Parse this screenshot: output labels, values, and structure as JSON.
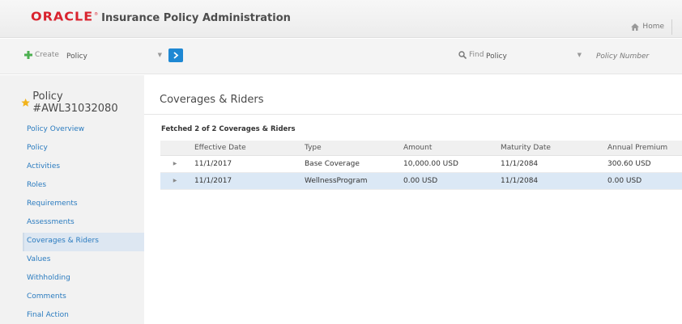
{
  "header": {
    "logo_brand": "ORACLE",
    "logo_mark": "®",
    "app_title": "Insurance Policy Administration",
    "home_label": "Home",
    "home_icon": "home-icon"
  },
  "toolbar": {
    "create_icon": "plus-icon",
    "create_label": "Create",
    "create_value": "Policy",
    "go_icon": "chevron-right-icon",
    "find_icon": "search-icon",
    "find_label": "Find",
    "find_value": "Policy",
    "policy_number_placeholder": "Policy Number"
  },
  "sidebar": {
    "policy_title": "Policy #AWL31032080",
    "favorite_icon": "star-icon",
    "items": [
      {
        "label": "Policy Overview",
        "active": false
      },
      {
        "label": "Policy",
        "active": false
      },
      {
        "label": "Activities",
        "active": false
      },
      {
        "label": "Roles",
        "active": false
      },
      {
        "label": "Requirements",
        "active": false
      },
      {
        "label": "Assessments",
        "active": false
      },
      {
        "label": "Coverages & Riders",
        "active": true
      },
      {
        "label": "Values",
        "active": false
      },
      {
        "label": "Withholding",
        "active": false
      },
      {
        "label": "Comments",
        "active": false
      },
      {
        "label": "Final Action",
        "active": false
      }
    ]
  },
  "main": {
    "title": "Coverages & Riders",
    "fetched_text": "Fetched 2 of 2 Coverages & Riders",
    "columns": [
      "Effective Date",
      "Type",
      "Amount",
      "Maturity Date",
      "Annual Premium"
    ],
    "rows": [
      {
        "effective_date": "11/1/2017",
        "type": "Base Coverage",
        "amount": "10,000.00 USD",
        "maturity_date": "11/1/2084",
        "annual_premium": "300.60 USD",
        "selected": false
      },
      {
        "effective_date": "11/1/2017",
        "type": "WellnessProgram",
        "amount": "0.00 USD",
        "maturity_date": "11/1/2084",
        "annual_premium": "0.00 USD",
        "selected": true
      }
    ],
    "expand_icon": "triangle-right-icon"
  },
  "colors": {
    "brand_red": "#d9232e",
    "link_blue": "#2a7bbf",
    "button_blue": "#1e88d3",
    "selected_row": "#dbe8f5",
    "star_gold": "#f2b31b",
    "create_green": "#4caf50"
  }
}
